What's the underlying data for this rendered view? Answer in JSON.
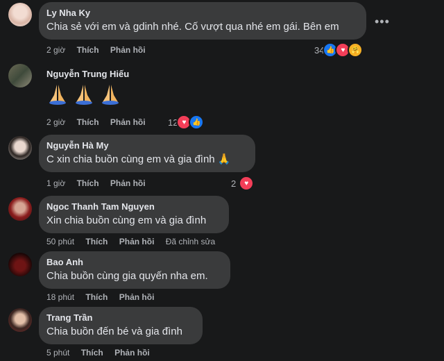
{
  "comments": [
    {
      "name": "Ly Nha Ky",
      "text": "Chia sẻ với em và gdinh nhé. Cố vượt qua nhé em gái. Bên em",
      "time": "2 giờ",
      "like": "Thích",
      "reply": "Phản hồi",
      "reaction_count": "34",
      "reaction_icons": [
        "like-icon",
        "love-icon",
        "care-icon"
      ]
    },
    {
      "name": "Nguyễn Trung Hiếu",
      "emoji": "🙏🙏🙏",
      "time": "2 giờ",
      "like": "Thích",
      "reply": "Phản hồi",
      "reaction_count": "12",
      "reaction_icons": [
        "love-icon",
        "like-icon"
      ]
    },
    {
      "name": "Nguyễn Hà My",
      "text": "C xin chia buồn cùng em và gia đình 🙏",
      "time": "1 giờ",
      "like": "Thích",
      "reply": "Phản hồi",
      "reaction_count": "2",
      "reaction_icons": [
        "love-icon"
      ]
    },
    {
      "name": "Ngoc Thanh Tam Nguyen",
      "text": "Xin chia buồn cùng em và gia đình",
      "time": "50 phút",
      "like": "Thích",
      "reply": "Phản hồi",
      "edited": "Đã chỉnh sửa"
    },
    {
      "name": "Bao Anh",
      "text": "Chia buồn cùng gia quyến nha em.",
      "time": "18 phút",
      "like": "Thích",
      "reply": "Phản hồi"
    },
    {
      "name": "Trang Trần",
      "text": "Chia buồn đến bé và gia đình",
      "time": "5 phút",
      "like": "Thích",
      "reply": "Phản hồi"
    }
  ],
  "colors": {
    "background": "#18191a",
    "bubble": "#3a3b3c",
    "text": "#e4e6eb",
    "meta": "#b0b3b8",
    "like": "#1877f2",
    "love": "#f33e58"
  }
}
